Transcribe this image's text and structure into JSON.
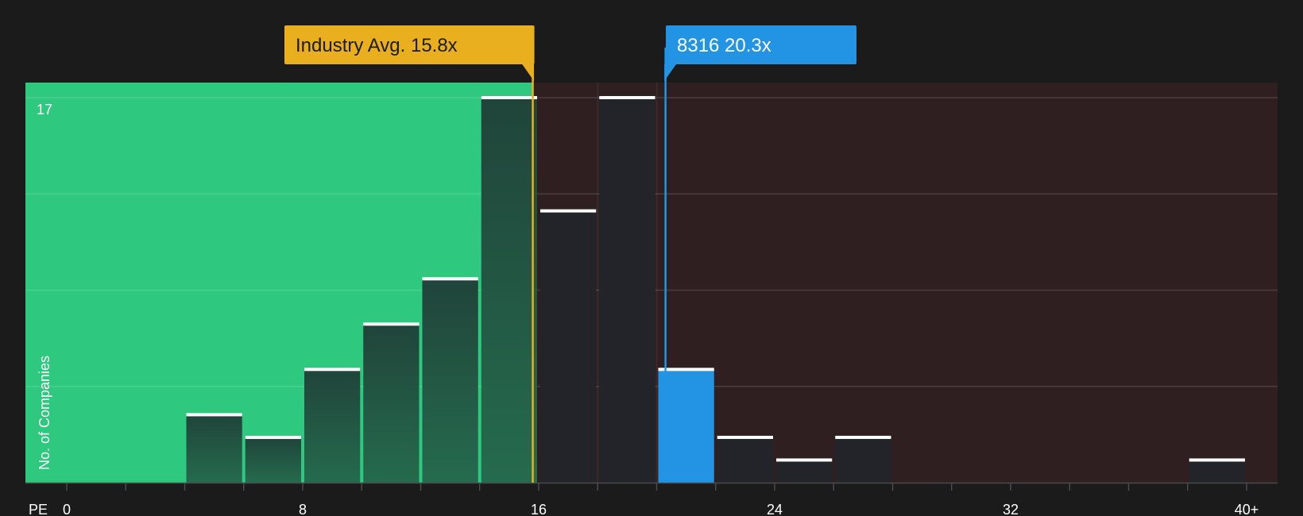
{
  "chart_data": {
    "type": "bar",
    "x_axis_label": "PE",
    "x_ticks": [
      "0",
      "8",
      "16",
      "24",
      "32",
      "40+"
    ],
    "x_range": [
      0,
      40
    ],
    "bin_width": 2,
    "y_axis_label": "No. of Companies",
    "y_max_label": "17",
    "ylim": [
      0,
      17
    ],
    "bins": [
      {
        "start": 4,
        "count": 3,
        "highlight": false
      },
      {
        "start": 6,
        "count": 2,
        "highlight": false
      },
      {
        "start": 8,
        "count": 5,
        "highlight": false
      },
      {
        "start": 10,
        "count": 7,
        "highlight": false
      },
      {
        "start": 12,
        "count": 9,
        "highlight": false
      },
      {
        "start": 14,
        "count": 17,
        "highlight": false
      },
      {
        "start": 16,
        "count": 12,
        "highlight": false
      },
      {
        "start": 18,
        "count": 17,
        "highlight": false
      },
      {
        "start": 20,
        "count": 5,
        "highlight": true
      },
      {
        "start": 22,
        "count": 2,
        "highlight": false
      },
      {
        "start": 24,
        "count": 1,
        "highlight": false
      },
      {
        "start": 26,
        "count": 2,
        "highlight": false
      },
      {
        "start": 38,
        "count": 1,
        "highlight": false
      }
    ],
    "industry_avg": {
      "value": 15.8,
      "label": "Industry Avg. 15.8x"
    },
    "company": {
      "value": 20.3,
      "label": "8316 20.3x"
    },
    "colors": {
      "background": "#1b1b1c",
      "undervalued_region": "#2ec87f",
      "overvalued_region": "#2f1f20",
      "bar_dark": "#23232a",
      "highlight_bar": "#2394e3",
      "industry_callout": "#e9af1e",
      "company_callout": "#2394e3",
      "cap_line": "#ffffff"
    }
  }
}
